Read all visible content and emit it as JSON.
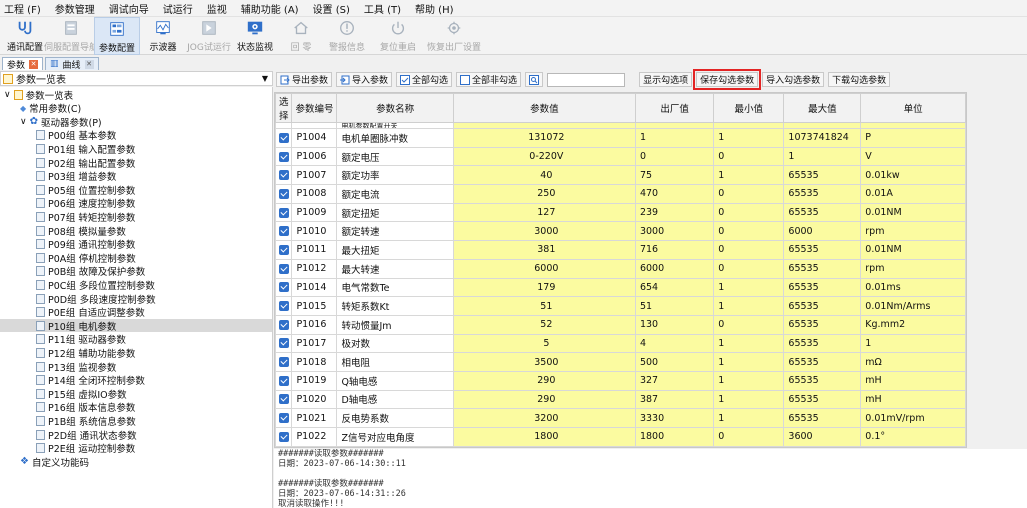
{
  "menubar": [
    "工程 (F)",
    "参数管理",
    "调试向导",
    "试运行",
    "监视",
    "辅助功能 (A)",
    "设置 (S)",
    "工具 (T)",
    "帮助 (H)"
  ],
  "toolbar": [
    {
      "label": "通讯配置",
      "icon": "connection-icon",
      "enabled": true
    },
    {
      "label": "伺服配置导航",
      "icon": "wizard-icon",
      "enabled": false
    },
    {
      "label": "参数配置",
      "icon": "parameter-icon",
      "enabled": true,
      "active": true
    },
    {
      "label": "示波器",
      "icon": "oscilloscope-icon",
      "enabled": true
    },
    {
      "label": "JOG试运行",
      "icon": "jog-icon",
      "enabled": false
    },
    {
      "label": "状态监视",
      "icon": "monitor-icon",
      "enabled": true
    },
    {
      "label": "回  零",
      "icon": "home-icon",
      "enabled": false
    },
    {
      "label": "警报信息",
      "icon": "alarm-icon",
      "enabled": false
    },
    {
      "label": "复位重启",
      "icon": "power-icon",
      "enabled": false
    },
    {
      "label": "恢复出厂设置",
      "icon": "factory-reset-icon",
      "enabled": false
    }
  ],
  "tabs": [
    {
      "label": "参数",
      "closable": true
    },
    {
      "label": "曲线",
      "closable": true
    }
  ],
  "left_panel": {
    "title": "参数一览表",
    "tree": [
      {
        "label": "参数一览表",
        "level": 0,
        "type": "root"
      },
      {
        "label": "常用参数(C)",
        "level": 1,
        "type": "common"
      },
      {
        "label": "驱动器参数(P)",
        "level": 1,
        "type": "gear"
      },
      {
        "label": "P00组 基本参数",
        "level": 2
      },
      {
        "label": "P01组 输入配置参数",
        "level": 2
      },
      {
        "label": "P02组 输出配置参数",
        "level": 2
      },
      {
        "label": "P03组 增益参数",
        "level": 2
      },
      {
        "label": "P05组 位置控制参数",
        "level": 2
      },
      {
        "label": "P06组 速度控制参数",
        "level": 2
      },
      {
        "label": "P07组 转矩控制参数",
        "level": 2
      },
      {
        "label": "P08组 模拟量参数",
        "level": 2
      },
      {
        "label": "P09组 通讯控制参数",
        "level": 2
      },
      {
        "label": "P0A组 停机控制参数",
        "level": 2
      },
      {
        "label": "P0B组 故障及保护参数",
        "level": 2
      },
      {
        "label": "P0C组 多段位置控制参数",
        "level": 2
      },
      {
        "label": "P0D组 多段速度控制参数",
        "level": 2
      },
      {
        "label": "P0E组 自适应调整参数",
        "level": 2
      },
      {
        "label": "P10组 电机参数",
        "level": 2,
        "selected": true
      },
      {
        "label": "P11组 驱动器参数",
        "level": 2
      },
      {
        "label": "P12组 辅助功能参数",
        "level": 2
      },
      {
        "label": "P13组 监视参数",
        "level": 2
      },
      {
        "label": "P14组 全闭环控制参数",
        "level": 2
      },
      {
        "label": "P15组 虚拟IO参数",
        "level": 2
      },
      {
        "label": "P16组 版本信息参数",
        "level": 2
      },
      {
        "label": "P1B组 系统信息参数",
        "level": 2
      },
      {
        "label": "P2D组 通讯状态参数",
        "level": 2
      },
      {
        "label": "P2E组 运动控制参数",
        "level": 2
      },
      {
        "label": "自定义功能码",
        "level": 0,
        "type": "custom"
      }
    ]
  },
  "param_toolbar": {
    "export": "导出参数",
    "import": "导入参数",
    "select_all": "全部勾选",
    "deselect_all": "全部非勾选",
    "show_checked": "显示勾选项",
    "save_checked": "保存勾选参数",
    "import_checked": "导入勾选参数",
    "download_checked": "下载勾选参数"
  },
  "table": {
    "headers": [
      "选择",
      "参数编号",
      "参数名称",
      "参数值",
      "出厂值",
      "最小值",
      "最大值",
      "单位"
    ],
    "partial_name": "电机参数配置开关",
    "rows": [
      {
        "id": "P1004",
        "name": "电机单圈脉冲数",
        "value": "131072",
        "default": "1",
        "min": "1",
        "max": "1073741824",
        "unit": "P"
      },
      {
        "id": "P1006",
        "name": "额定电压",
        "value": "0-220V",
        "default": "0",
        "min": "0",
        "max": "1",
        "unit": "V"
      },
      {
        "id": "P1007",
        "name": "额定功率",
        "value": "40",
        "default": "75",
        "min": "1",
        "max": "65535",
        "unit": "0.01kw"
      },
      {
        "id": "P1008",
        "name": "额定电流",
        "value": "250",
        "default": "470",
        "min": "0",
        "max": "65535",
        "unit": "0.01A"
      },
      {
        "id": "P1009",
        "name": "额定扭矩",
        "value": "127",
        "default": "239",
        "min": "0",
        "max": "65535",
        "unit": "0.01NM"
      },
      {
        "id": "P1010",
        "name": "额定转速",
        "value": "3000",
        "default": "3000",
        "min": "0",
        "max": "6000",
        "unit": "rpm"
      },
      {
        "id": "P1011",
        "name": "最大扭矩",
        "value": "381",
        "default": "716",
        "min": "0",
        "max": "65535",
        "unit": "0.01NM"
      },
      {
        "id": "P1012",
        "name": "最大转速",
        "value": "6000",
        "default": "6000",
        "min": "0",
        "max": "65535",
        "unit": "rpm"
      },
      {
        "id": "P1014",
        "name": "电气常数Te",
        "value": "179",
        "default": "654",
        "min": "1",
        "max": "65535",
        "unit": "0.01ms"
      },
      {
        "id": "P1015",
        "name": "转矩系数Kt",
        "value": "51",
        "default": "51",
        "min": "1",
        "max": "65535",
        "unit": "0.01Nm/Arms"
      },
      {
        "id": "P1016",
        "name": "转动惯量Jm",
        "value": "52",
        "default": "130",
        "min": "0",
        "max": "65535",
        "unit": "Kg.mm2"
      },
      {
        "id": "P1017",
        "name": "极对数",
        "value": "5",
        "default": "4",
        "min": "1",
        "max": "65535",
        "unit": "1"
      },
      {
        "id": "P1018",
        "name": "相电阻",
        "value": "3500",
        "default": "500",
        "min": "1",
        "max": "65535",
        "unit": "mΩ"
      },
      {
        "id": "P1019",
        "name": "Q轴电感",
        "value": "290",
        "default": "327",
        "min": "1",
        "max": "65535",
        "unit": "mH"
      },
      {
        "id": "P1020",
        "name": "D轴电感",
        "value": "290",
        "default": "387",
        "min": "1",
        "max": "65535",
        "unit": "mH"
      },
      {
        "id": "P1021",
        "name": "反电势系数",
        "value": "3200",
        "default": "3330",
        "min": "1",
        "max": "65535",
        "unit": "0.01mV/rpm"
      },
      {
        "id": "P1022",
        "name": "Z信号对应电角度",
        "value": "1800",
        "default": "1800",
        "min": "0",
        "max": "3600",
        "unit": "0.1°"
      }
    ]
  },
  "log": [
    "#######读取参数#######",
    "日期：2023-07-06-14:30::11",
    "",
    "#######读取参数#######",
    "日期：2023-07-06-14:31::26",
    "取消读取操作!!!"
  ],
  "colors": {
    "highlight_border": "#e32525",
    "value_cell": "#fbfba0",
    "checkbox": "#2f6fc9"
  }
}
